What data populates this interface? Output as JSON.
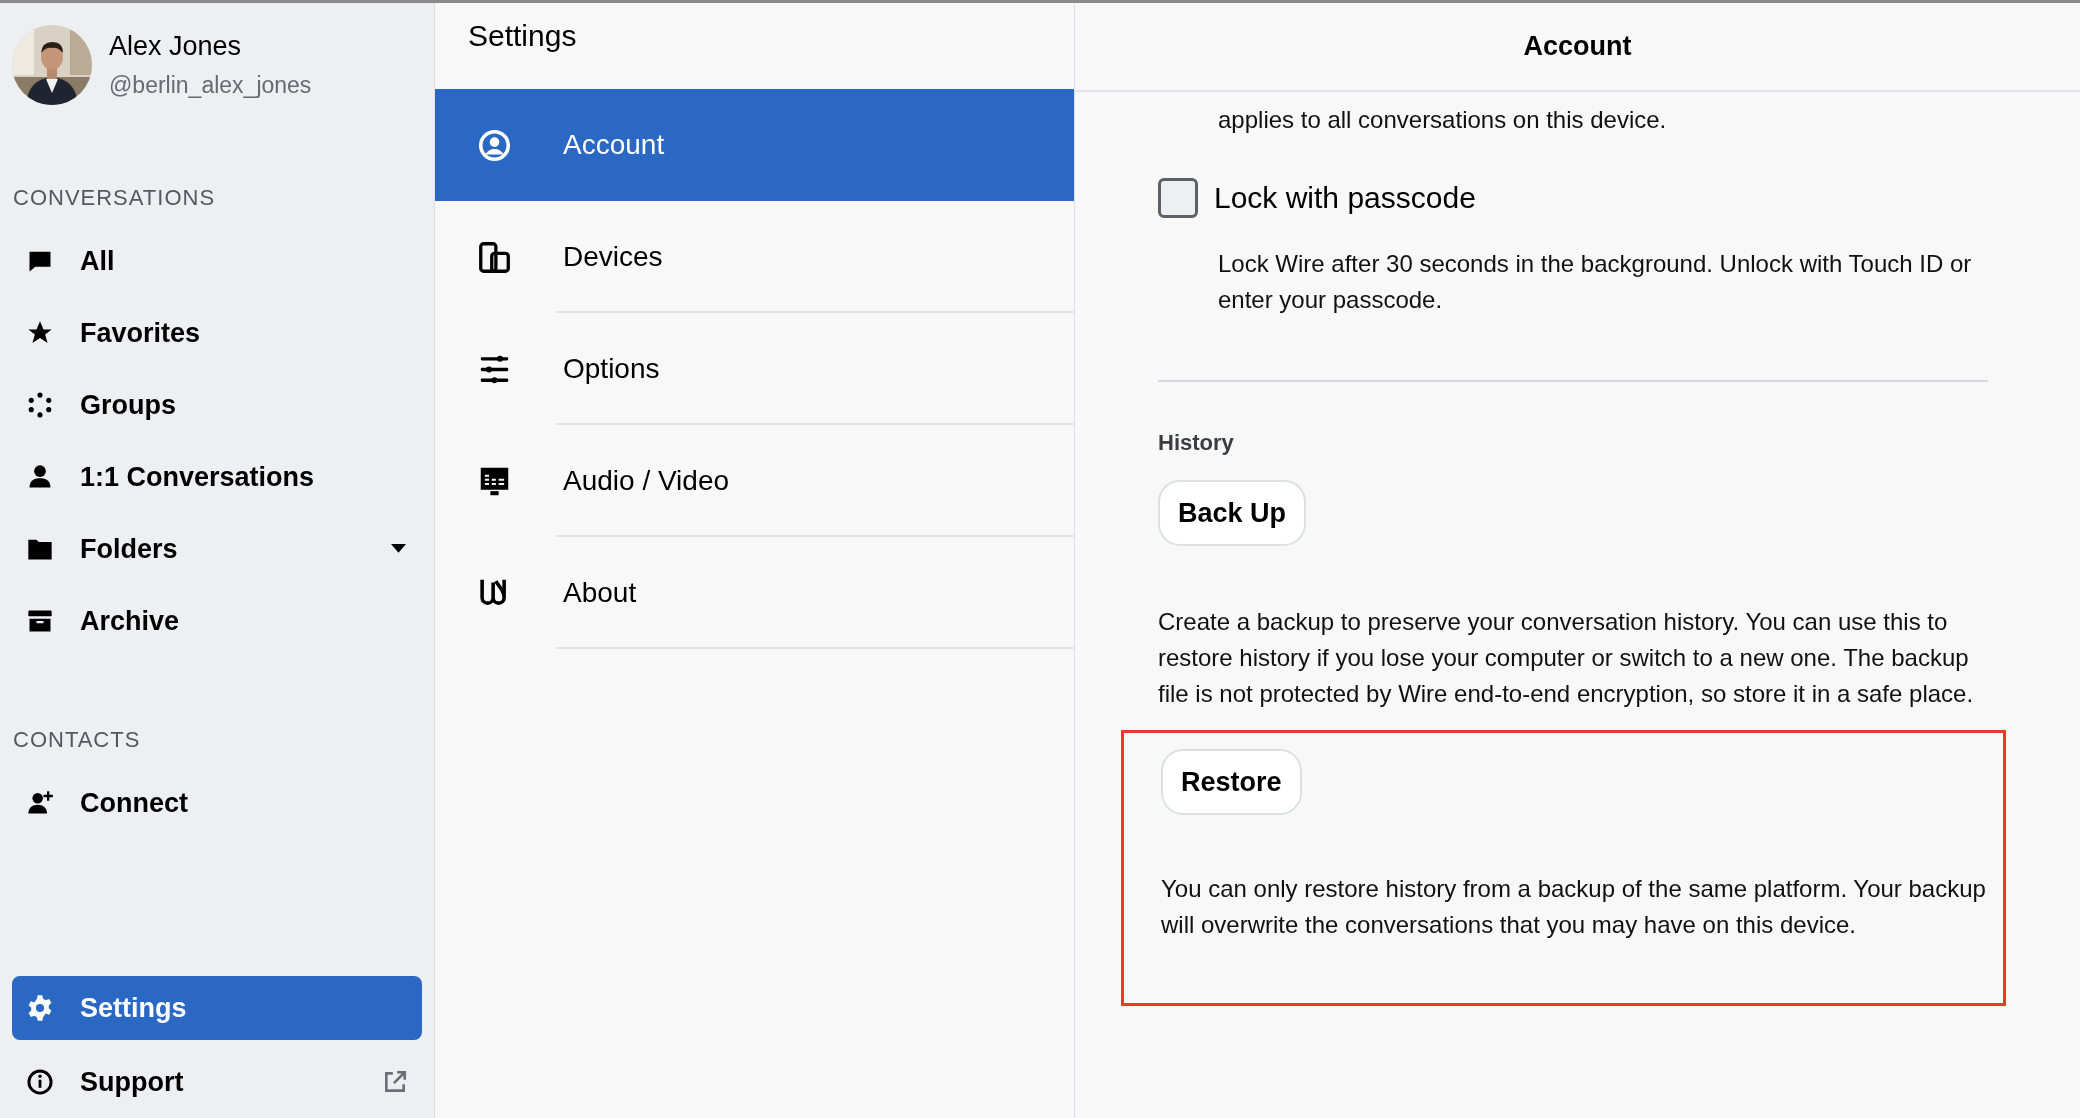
{
  "profile": {
    "name": "Alex Jones",
    "handle": "@berlin_alex_jones"
  },
  "sidebar": {
    "sections": [
      {
        "heading": "CONVERSATIONS",
        "items": [
          {
            "label": "All",
            "selected": false,
            "caret": false
          },
          {
            "label": "Favorites",
            "selected": false,
            "caret": false
          },
          {
            "label": "Groups",
            "selected": false,
            "caret": false
          },
          {
            "label": "1:1 Conversations",
            "selected": false,
            "caret": false
          },
          {
            "label": "Folders",
            "selected": false,
            "caret": true
          },
          {
            "label": "Archive",
            "selected": false,
            "caret": false
          }
        ]
      },
      {
        "heading": "CONTACTS",
        "items": [
          {
            "label": "Connect",
            "selected": false,
            "caret": false
          }
        ]
      }
    ],
    "bottom_items": [
      {
        "label": "Settings",
        "selected": true,
        "external": false
      },
      {
        "label": "Support",
        "selected": false,
        "external": true
      }
    ]
  },
  "settings_menu": {
    "title": "Settings",
    "items": [
      {
        "label": "Account",
        "selected": true
      },
      {
        "label": "Devices",
        "selected": false
      },
      {
        "label": "Options",
        "selected": false
      },
      {
        "label": "Audio / Video",
        "selected": false
      },
      {
        "label": "About",
        "selected": false
      }
    ]
  },
  "account": {
    "title": "Account",
    "partial_text": "applies to all conversations on this device.",
    "lock": {
      "label": "Lock with passcode",
      "checked": false,
      "description": "Lock Wire after 30 seconds in the background. Unlock with Touch ID or enter your passcode."
    },
    "history": {
      "heading": "History",
      "backup": {
        "button": "Back Up",
        "description": "Create a backup to preserve your conversation history. You can use this to restore history if you lose your computer or switch to a new one. The backup file is not protected by Wire end-to-end encryption, so store it in a safe place."
      },
      "restore": {
        "button": "Restore",
        "highlighted": true,
        "description": "You can only restore history from a backup of the same platform. Your backup will overwrite the conversations that you may have on this device."
      }
    }
  }
}
